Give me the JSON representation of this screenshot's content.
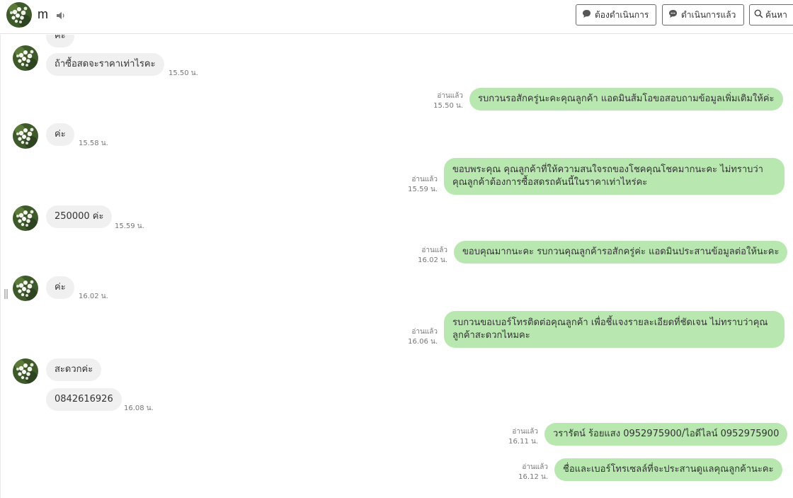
{
  "header": {
    "contact_name": "m",
    "btn_todo": "ต้องดำเนินการ",
    "btn_done": "ดำเนินการแล้ว",
    "btn_search": "ค้นหา",
    "icons": [
      "speaker-icon",
      "chat-bubble-icon",
      "chat-bubble-icon",
      "search-icon"
    ]
  },
  "messages": [
    {
      "dir": "in",
      "text": "ค่ะ",
      "time": ""
    },
    {
      "dir": "in",
      "text": "ถ้าซื้อสดจะราคาเท่าไรคะ",
      "time": "15.50 น."
    },
    {
      "dir": "out",
      "text": "รบกวนรอสักครู่นะคะคุณลูกค้า แอดมินส้มโอขอสอบถามข้อมูลเพิ่มเติมให้ค่ะ",
      "read": "อ่านแล้ว",
      "time": "15.50 น."
    },
    {
      "dir": "in",
      "text": "ค่ะ",
      "time": "15.58 น."
    },
    {
      "dir": "out",
      "text": "ขอบพระคุณ คุณลูกค้าที่ให้ความสนใจรถของโชคคุณโชคมากนะคะ ไม่ทราบว่าคุณลูกค้าต้องการซื้อสดรถคันนี้ในราคาเท่าไหร่คะ",
      "read": "อ่านแล้ว",
      "time": "15.59 น."
    },
    {
      "dir": "in",
      "text": "250000 ค่ะ",
      "time": "15.59 น."
    },
    {
      "dir": "out",
      "text": "ขอบคุณมากนะคะ รบกวนคุณลูกค้ารอสักครู่ค่ะ แอดมินประสานข้อมูลต่อให้นะคะ",
      "read": "อ่านแล้ว",
      "time": "16.02 น."
    },
    {
      "dir": "in",
      "text": "ค่ะ",
      "time": "16.02 น."
    },
    {
      "dir": "out",
      "text": "รบกวนขอเบอร์โทรติดต่อคุณลูกค้า เพื่อชี้แจงรายละเอียดที่ชัดเจน ไม่ทราบว่าคุณลูกค้าสะดวกไหมคะ",
      "read": "อ่านแล้ว",
      "time": "16.06 น."
    },
    {
      "dir": "in",
      "text": "สะดวกค่ะ",
      "time": ""
    },
    {
      "dir": "in",
      "text": "0842616926",
      "time": "16.08 น."
    },
    {
      "dir": "out",
      "text": "วรารัตน์ ร้อยแสง 0952975900/ไอดีไลน์ 0952975900",
      "read": "อ่านแล้ว",
      "time": "16.11 น."
    },
    {
      "dir": "out",
      "text": "ชื่อและเบอร์โทรเซลล์ที่จะประสานดูแลคุณลูกค้านะคะ",
      "read": "อ่านแล้ว",
      "time": "16.12 น."
    }
  ],
  "colors": {
    "outgoing_bubble": "#b8e8b0",
    "incoming_bubble": "#f0f0f0",
    "border": "#6b6b6b"
  }
}
